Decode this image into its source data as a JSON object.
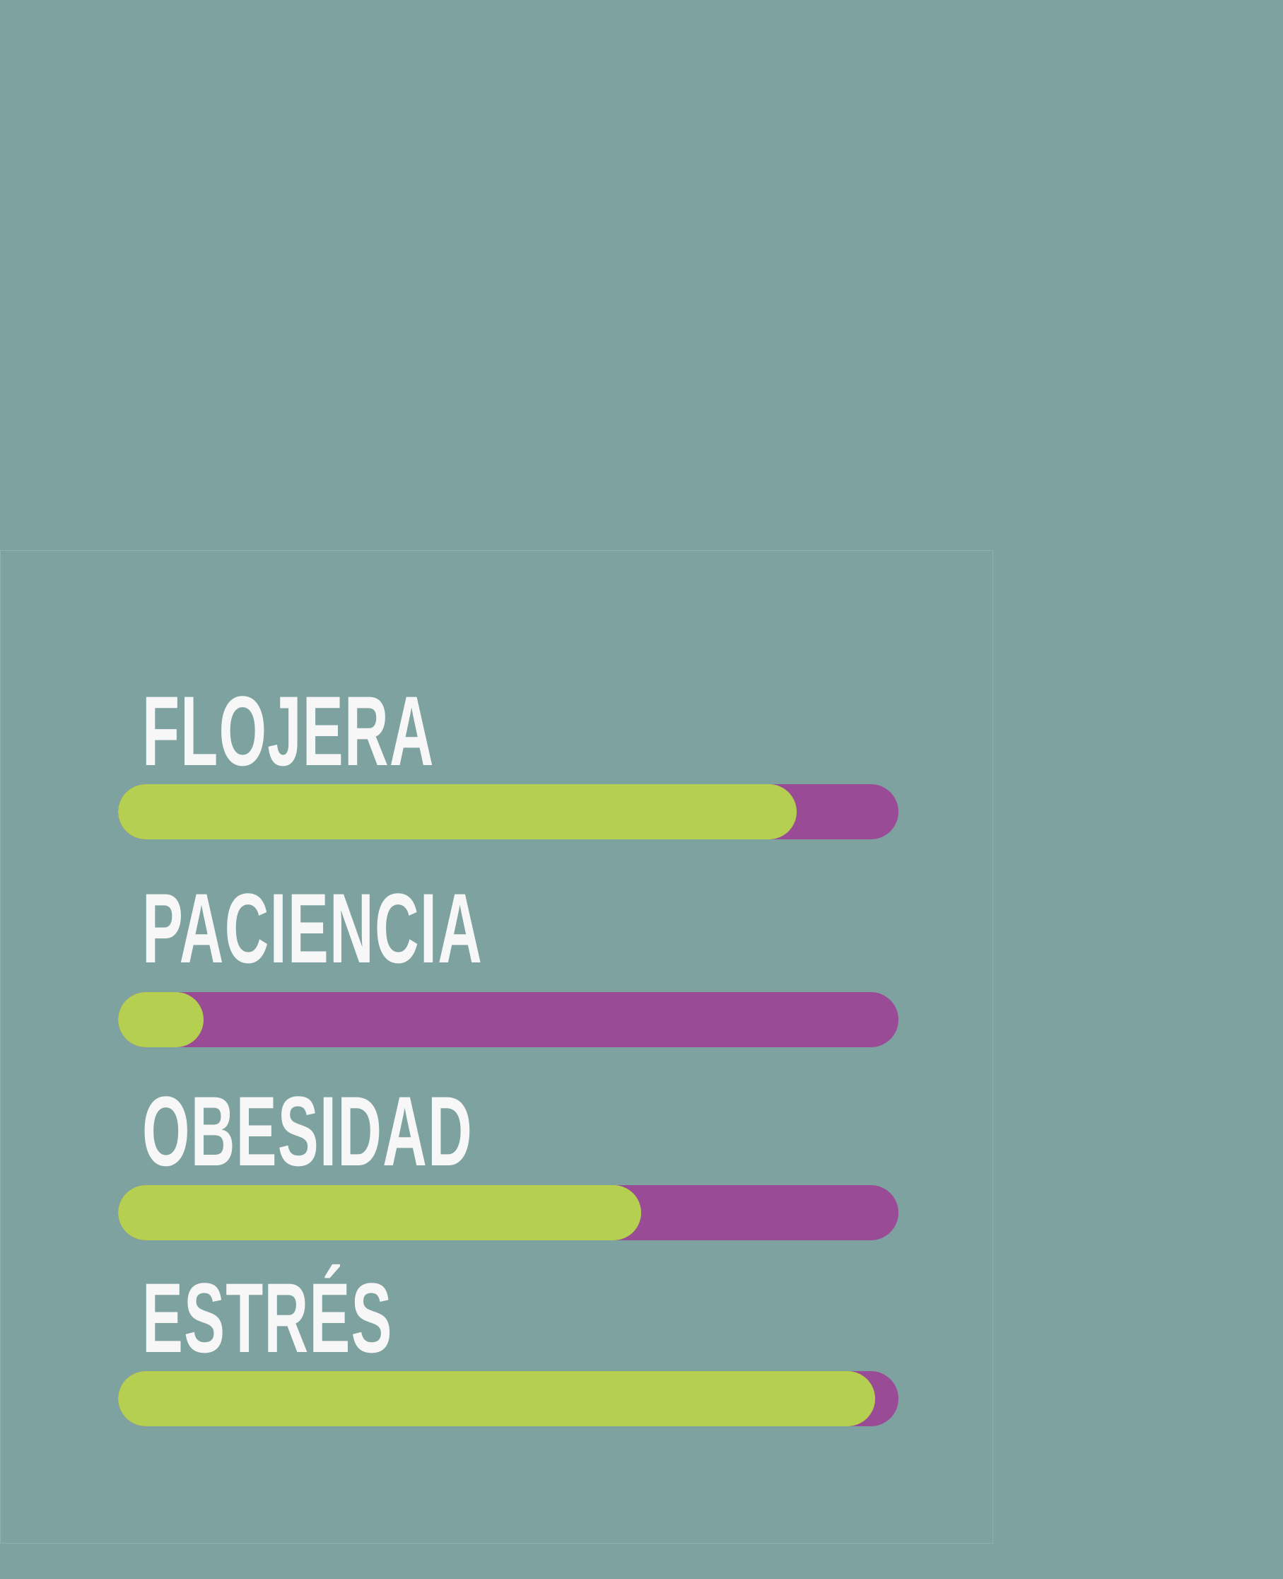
{
  "colors": {
    "background": "#7ea29f",
    "bar_fill": "#b5d051",
    "bar_track": "#9a4b95",
    "label_text": "#f7f7f7"
  },
  "stats": [
    {
      "label": "FLOJERA",
      "level_percent": 87
    },
    {
      "label": "PACIENCIA",
      "level_percent": 11
    },
    {
      "label": "OBESIDAD",
      "level_percent": 67
    },
    {
      "label": "ESTRÉS",
      "level_percent": 97
    }
  ]
}
